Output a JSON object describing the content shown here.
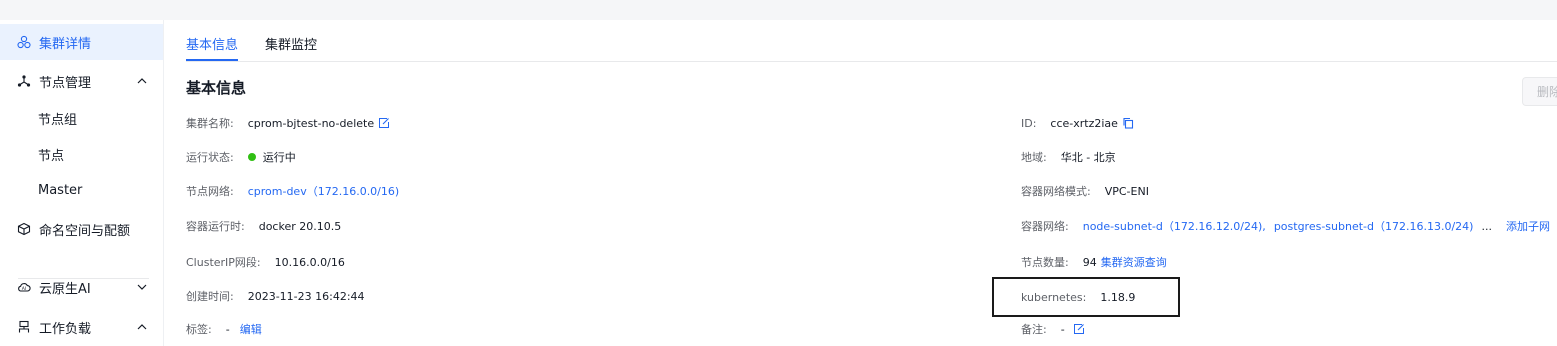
{
  "sidebar": {
    "items": [
      {
        "label": "集群详情",
        "icon": "cluster-icon"
      },
      {
        "label": "节点管理",
        "icon": "node-tree-icon"
      },
      {
        "label": "命名空间与配额",
        "icon": "cube-icon"
      },
      {
        "label": "云原生AI",
        "icon": "cloud-ai-icon"
      },
      {
        "label": "工作负载",
        "icon": "workload-icon"
      }
    ],
    "sub_items": [
      "节点组",
      "节点",
      "Master"
    ]
  },
  "tabs": [
    "基本信息",
    "集群监控"
  ],
  "section_title": "基本信息",
  "delete_label": "删除",
  "left_fields": {
    "cluster_name": {
      "label": "集群名称:",
      "value": "cprom-bjtest-no-delete"
    },
    "status": {
      "label": "运行状态:",
      "value": "运行中"
    },
    "node_network": {
      "label": "节点网络:",
      "value": "cprom-dev（172.16.0.0/16)"
    },
    "runtime": {
      "label": "容器运行时:",
      "value": "docker 20.10.5"
    },
    "clusterip": {
      "label": "ClusterIP网段:",
      "value": "10.16.0.0/16"
    },
    "created": {
      "label": "创建时间:",
      "value": "2023-11-23 16:42:44"
    },
    "tags": {
      "label": "标签:",
      "value": "-",
      "action": "编辑"
    }
  },
  "right_fields": {
    "id": {
      "label": "ID:",
      "value": "cce-xrtz2iae"
    },
    "region": {
      "label": "地域:",
      "value": "华北 - 北京"
    },
    "net_mode": {
      "label": "容器网络模式:",
      "value": "VPC-ENI"
    },
    "container_net": {
      "label": "容器网络:",
      "value1": "node-subnet-d（172.16.12.0/24),",
      "value2": "postgres-subnet-d（172.16.13.0/24)",
      "more": "...",
      "action": "添加子网"
    },
    "node_count": {
      "label": "节点数量:",
      "value": "94",
      "action": "集群资源查询"
    },
    "kubernetes": {
      "label": "kubernetes:",
      "value": "1.18.9"
    },
    "remark": {
      "label": "备注:",
      "value": "-"
    }
  },
  "colors": {
    "accent": "#2468f2",
    "status_running": "#30bf13",
    "active_bg": "#eaf2fe"
  }
}
